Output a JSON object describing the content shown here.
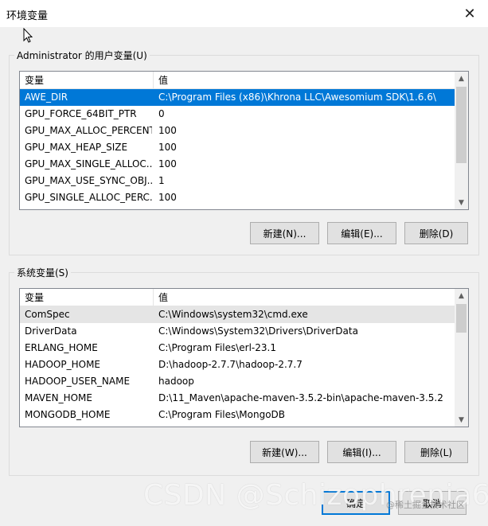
{
  "window": {
    "title": "环境变量",
    "close_glyph": "✕"
  },
  "user_vars": {
    "label": "Administrator 的用户变量(U)",
    "col_name": "变量",
    "col_value": "值",
    "rows": [
      {
        "name": "AWE_DIR",
        "value": "C:\\Program Files (x86)\\Khrona LLC\\Awesomium SDK\\1.6.6\\"
      },
      {
        "name": "GPU_FORCE_64BIT_PTR",
        "value": "0"
      },
      {
        "name": "GPU_MAX_ALLOC_PERCENT",
        "value": "100"
      },
      {
        "name": "GPU_MAX_HEAP_SIZE",
        "value": "100"
      },
      {
        "name": "GPU_MAX_SINGLE_ALLOC...",
        "value": "100"
      },
      {
        "name": "GPU_MAX_USE_SYNC_OBJ...",
        "value": "1"
      },
      {
        "name": "GPU_SINGLE_ALLOC_PERC...",
        "value": "100"
      }
    ],
    "buttons": {
      "new": "新建(N)...",
      "edit": "编辑(E)...",
      "delete": "删除(D)"
    }
  },
  "system_vars": {
    "label": "系统变量(S)",
    "col_name": "变量",
    "col_value": "值",
    "rows": [
      {
        "name": "ComSpec",
        "value": "C:\\Windows\\system32\\cmd.exe"
      },
      {
        "name": "DriverData",
        "value": "C:\\Windows\\System32\\Drivers\\DriverData"
      },
      {
        "name": "ERLANG_HOME",
        "value": "C:\\Program Files\\erl-23.1"
      },
      {
        "name": "HADOOP_HOME",
        "value": "D:\\hadoop-2.7.7\\hadoop-2.7.7"
      },
      {
        "name": "HADOOP_USER_NAME",
        "value": "hadoop"
      },
      {
        "name": "MAVEN_HOME",
        "value": "D:\\11_Maven\\apache-maven-3.5.2-bin\\apache-maven-3.5.2"
      },
      {
        "name": "MONGODB_HOME",
        "value": "C:\\Program Files\\MongoDB"
      }
    ],
    "buttons": {
      "new": "新建(W)...",
      "edit": "编辑(I)...",
      "delete": "删除(L)"
    }
  },
  "footer": {
    "ok": "确定",
    "cancel": "取消"
  },
  "watermark": {
    "main": "CSDN @Schizophrenia6",
    "secondary": "@稀土掘金技术社区"
  },
  "icons": {
    "scroll_up": "▲",
    "scroll_down": "▼"
  }
}
